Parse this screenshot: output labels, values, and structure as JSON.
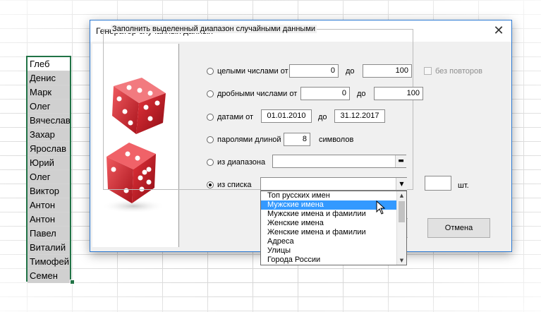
{
  "sheet": {
    "names": [
      "Глеб",
      "Денис",
      "Марк",
      "Олег",
      "Вячеслав",
      "Захар",
      "Ярослав",
      "Юрий",
      "Олег",
      "Виктор",
      "Антон",
      "Антон",
      "Павел",
      "Виталий",
      "Тимофей",
      "Семен"
    ]
  },
  "dialog": {
    "title": "Генератор случайных данных",
    "close": "✕",
    "group_label": "Заполнить выделенный диапазон случайными данными",
    "integers": {
      "label": "целыми числами от",
      "from": "0",
      "to_label": "до",
      "to": "100",
      "no_repeat": "без повторов"
    },
    "fractions": {
      "label": "дробными числами от",
      "from": "0",
      "to_label": "до",
      "to": "100"
    },
    "dates": {
      "label": "датами от",
      "from": "01.01.2010",
      "to_label": "до",
      "to": "31.12.2017"
    },
    "passwords": {
      "label": "паролями длиной",
      "length": "8",
      "suffix": "символов"
    },
    "range": {
      "label": "из диапазона",
      "value": "",
      "btn": "▬"
    },
    "list": {
      "label": "из списка",
      "value": "",
      "count": "",
      "count_suffix": "шт.",
      "arrow": "▼"
    },
    "cancel": "Отмена",
    "selected_option": "из списка"
  },
  "dropdown": {
    "items": [
      "Топ русских имен",
      "Мужские имена",
      "Мужские имена и фамилии",
      "Женские имена",
      "Женские имена и фамилии",
      "Адреса",
      "Улицы",
      "Города России"
    ],
    "highlighted": "Мужские имена",
    "up": "▲",
    "down": "▼"
  },
  "colors": {
    "accent": "#2b79d3",
    "selection": "#3399ff",
    "excel_green": "#217346",
    "dice": "#d9252f"
  },
  "icons": [
    "close-icon",
    "dice-image",
    "dropdown-arrow-icon",
    "collapse-range-icon",
    "mouse-cursor-icon"
  ]
}
